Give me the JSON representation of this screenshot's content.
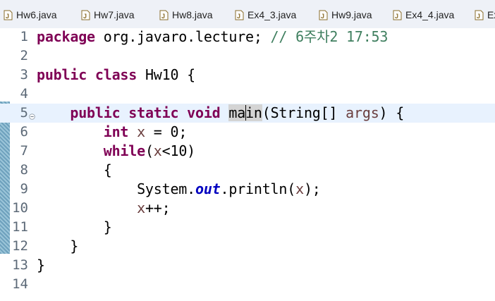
{
  "tabs": [
    {
      "label": "Hw6.java"
    },
    {
      "label": "Hw7.java"
    },
    {
      "label": "Hw8.java"
    },
    {
      "label": "Ex4_3.java"
    },
    {
      "label": "Hw9.java"
    },
    {
      "label": "Ex4_4.java"
    },
    {
      "label": "Ex"
    }
  ],
  "editor": {
    "current_line": 5,
    "lines": [
      {
        "num": "1"
      },
      {
        "num": "2"
      },
      {
        "num": "3"
      },
      {
        "num": "4"
      },
      {
        "num": "5"
      },
      {
        "num": "6"
      },
      {
        "num": "7"
      },
      {
        "num": "8"
      },
      {
        "num": "9"
      },
      {
        "num": "10"
      },
      {
        "num": "11"
      },
      {
        "num": "12"
      },
      {
        "num": "13"
      },
      {
        "num": "14"
      }
    ],
    "code": {
      "l1_kw": "package",
      "l1_pkg": " org.javaro.lecture;",
      "l1_comment": " // 6주차2 17:53",
      "l3_kw1": "public",
      "l3_kw2": "class",
      "l3_name": " Hw10 {",
      "l5_kw1": "public",
      "l5_kw2": "static",
      "l5_kw3": "void",
      "l5_name_a": "ma",
      "l5_name_b": "in",
      "l5_params": "(String[] ",
      "l5_args": "args",
      "l5_end": ") {",
      "l6_kw": "int",
      "l6_var": "x",
      "l6_rest": " = 0;",
      "l7_kw": "while",
      "l7_open": "(",
      "l7_var": "x",
      "l7_rest": "<10)",
      "l8": "{",
      "l9_a": "System.",
      "l9_field": "out",
      "l9_b": ".println(",
      "l9_var": "x",
      "l9_c": ");",
      "l10_var": "x",
      "l10_rest": "++;",
      "l11": "}",
      "l12": "}",
      "l13": "}"
    }
  }
}
